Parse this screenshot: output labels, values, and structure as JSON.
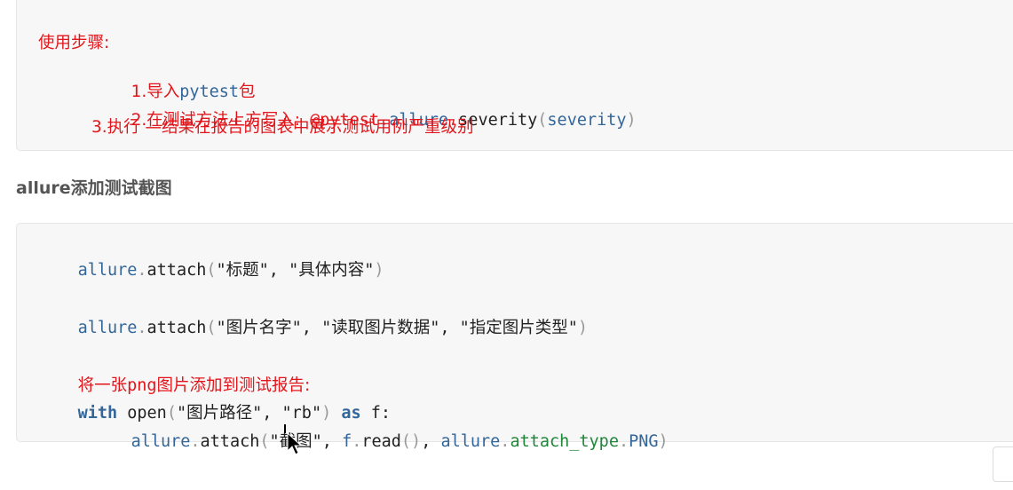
{
  "section1": {
    "steps_heading": "使用步骤:",
    "step1_prefix": "1.导入",
    "step1_code": "pytest",
    "step1_suffix": "包",
    "step2_prefix": "2.在测试方法上方写入:",
    "step2_code_at": "@pytest",
    "step2_code_dot1": ".",
    "step2_code_allure": "allure",
    "step2_code_dot2": ".",
    "step2_code_severity": "severity",
    "step2_code_lp": "(",
    "step2_code_arg": "severity",
    "step2_code_rp": ")",
    "step3": "3.执行 —结果在报告的图表中展示测试用例严重级别"
  },
  "section2": {
    "heading_bold": "allure",
    "heading_rest": "添加测试截图",
    "line1": {
      "obj": "allure",
      "dot": ".",
      "fn": "attach",
      "lp": "(",
      "arg1": "\"标题\"",
      "comma": ",",
      "arg2": "\"具体内容\"",
      "rp": ")"
    },
    "line2": {
      "obj": "allure",
      "dot": ".",
      "fn": "attach",
      "lp": "(",
      "arg1": "\"图片名字\"",
      "comma1": ",",
      "arg2": "\"读取图片数据\"",
      "comma2": ",",
      "arg3": "\"指定图片类型\"",
      "rp": ")"
    },
    "comment_a": "将一张",
    "comment_b": "png",
    "comment_c": "图片添加到测试报告:",
    "line3": {
      "kw_with": "with",
      "fn_open": "open",
      "lp": "(",
      "arg1": "\"图片路径\"",
      "comma": ",",
      "arg2": "\"rb\"",
      "rp": ")",
      "kw_as": "as",
      "var": "f:"
    },
    "line4": {
      "obj": "allure",
      "dot": ".",
      "fn": "attach",
      "lp": "(",
      "arg1": "\"截图\"",
      "comma1": ",",
      "f": "f",
      "dot2": ".",
      "read": "read",
      "paren": "()",
      "comma2": ",",
      "obj2": "allure",
      "dot3": ".",
      "attr": "attach_type",
      "dot4": ".",
      "png": "PNG",
      "rp": ")"
    }
  }
}
